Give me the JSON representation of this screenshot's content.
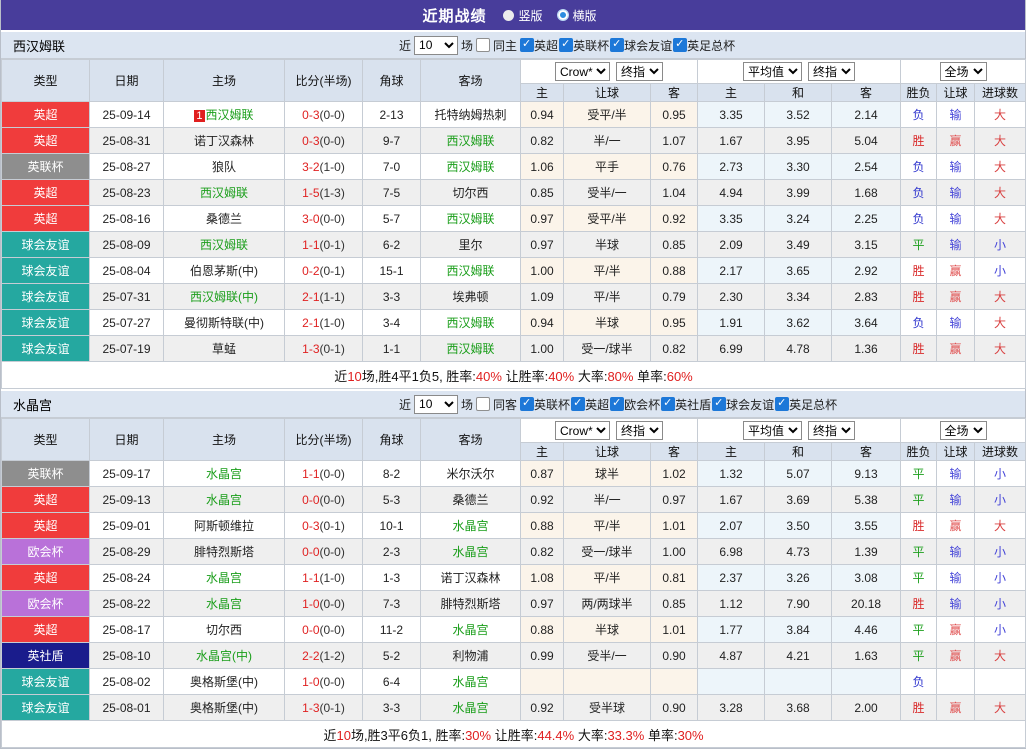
{
  "title_bar": {
    "title": "近期战绩",
    "vertical_label": "竖版",
    "horizontal_label": "横版"
  },
  "labels": {
    "near": "近",
    "games": "场"
  },
  "selects": {
    "bookmaker": "Crow*",
    "final1": "终指",
    "average": "平均值",
    "final2": "终指",
    "scope": "全场"
  },
  "columns": {
    "type": "类型",
    "date": "日期",
    "home": "主场",
    "score": "比分(半场)",
    "corner": "角球",
    "away": "客场",
    "sub": [
      "主",
      "让球",
      "客",
      "主",
      "和",
      "客",
      "胜负",
      "让球",
      "进球数"
    ]
  },
  "colors": {
    "league": {
      "英超": "#f03c3c",
      "英联杯": "#8e8e8e",
      "球会友谊": "#25a8a0",
      "欧会杯": "#b971d9",
      "英社盾": "#1a1c8c",
      "英足总杯": "#8e8e8e"
    },
    "outcome": {
      "胜": "#d92b2b",
      "平": "#1fa01f",
      "负": "#2f35ce"
    },
    "handicap": {
      "赢": "#e05050",
      "输": "#4545d8"
    },
    "goals": {
      "大": "#d94040",
      "小": "#4545d8"
    }
  },
  "sections": [
    {
      "team": "西汉姆联",
      "count": "10",
      "same_label": "同主",
      "leagues": [
        "英超",
        "英联杯",
        "球会友谊",
        "英足总杯"
      ],
      "rows": [
        {
          "type": "英超",
          "date": "25-09-14",
          "home": "西汉姆联",
          "home_focus": true,
          "rank": "1",
          "score": "0-3",
          "half": "(0-0)",
          "corner": "2-13",
          "away": "托特纳姆热刺",
          "away_focus": false,
          "lh": "0.94",
          "line": "受平/半",
          "la": "0.95",
          "ah": "3.35",
          "ad": "3.52",
          "aa": "2.14",
          "res": "负",
          "hres": "输",
          "gres": "大"
        },
        {
          "type": "英超",
          "date": "25-08-31",
          "home": "诺丁汉森林",
          "home_focus": false,
          "rank": "",
          "score": "0-3",
          "half": "(0-0)",
          "corner": "9-7",
          "away": "西汉姆联",
          "away_focus": true,
          "lh": "0.82",
          "line": "半/一",
          "la": "1.07",
          "ah": "1.67",
          "ad": "3.95",
          "aa": "5.04",
          "res": "胜",
          "hres": "赢",
          "gres": "大"
        },
        {
          "type": "英联杯",
          "date": "25-08-27",
          "home": "狼队",
          "home_focus": false,
          "rank": "",
          "score": "3-2",
          "half": "(1-0)",
          "corner": "7-0",
          "away": "西汉姆联",
          "away_focus": true,
          "lh": "1.06",
          "line": "平手",
          "la": "0.76",
          "ah": "2.73",
          "ad": "3.30",
          "aa": "2.54",
          "res": "负",
          "hres": "输",
          "gres": "大"
        },
        {
          "type": "英超",
          "date": "25-08-23",
          "home": "西汉姆联",
          "home_focus": true,
          "rank": "",
          "score": "1-5",
          "half": "(1-3)",
          "corner": "7-5",
          "away": "切尔西",
          "away_focus": false,
          "lh": "0.85",
          "line": "受半/一",
          "la": "1.04",
          "ah": "4.94",
          "ad": "3.99",
          "aa": "1.68",
          "res": "负",
          "hres": "输",
          "gres": "大"
        },
        {
          "type": "英超",
          "date": "25-08-16",
          "home": "桑德兰",
          "home_focus": false,
          "rank": "",
          "score": "3-0",
          "half": "(0-0)",
          "corner": "5-7",
          "away": "西汉姆联",
          "away_focus": true,
          "lh": "0.97",
          "line": "受平/半",
          "la": "0.92",
          "ah": "3.35",
          "ad": "3.24",
          "aa": "2.25",
          "res": "负",
          "hres": "输",
          "gres": "大"
        },
        {
          "type": "球会友谊",
          "date": "25-08-09",
          "home": "西汉姆联",
          "home_focus": true,
          "rank": "",
          "score": "1-1",
          "half": "(0-1)",
          "corner": "6-2",
          "away": "里尔",
          "away_focus": false,
          "lh": "0.97",
          "line": "半球",
          "la": "0.85",
          "ah": "2.09",
          "ad": "3.49",
          "aa": "3.15",
          "res": "平",
          "hres": "输",
          "gres": "小"
        },
        {
          "type": "球会友谊",
          "date": "25-08-04",
          "home": "伯恩茅斯(中)",
          "home_focus": false,
          "rank": "",
          "score": "0-2",
          "half": "(0-1)",
          "corner": "15-1",
          "away": "西汉姆联",
          "away_focus": true,
          "lh": "1.00",
          "line": "平/半",
          "la": "0.88",
          "ah": "2.17",
          "ad": "3.65",
          "aa": "2.92",
          "res": "胜",
          "hres": "赢",
          "gres": "小"
        },
        {
          "type": "球会友谊",
          "date": "25-07-31",
          "home": "西汉姆联(中)",
          "home_focus": true,
          "rank": "",
          "score": "2-1",
          "half": "(1-1)",
          "corner": "3-3",
          "away": "埃弗顿",
          "away_focus": false,
          "lh": "1.09",
          "line": "平/半",
          "la": "0.79",
          "ah": "2.30",
          "ad": "3.34",
          "aa": "2.83",
          "res": "胜",
          "hres": "赢",
          "gres": "大"
        },
        {
          "type": "球会友谊",
          "date": "25-07-27",
          "home": "曼彻斯特联(中)",
          "home_focus": false,
          "rank": "",
          "score": "2-1",
          "half": "(1-0)",
          "corner": "3-4",
          "away": "西汉姆联",
          "away_focus": true,
          "lh": "0.94",
          "line": "半球",
          "la": "0.95",
          "ah": "1.91",
          "ad": "3.62",
          "aa": "3.64",
          "res": "负",
          "hres": "输",
          "gres": "大"
        },
        {
          "type": "球会友谊",
          "date": "25-07-19",
          "home": "草蜢",
          "home_focus": false,
          "rank": "",
          "score": "1-3",
          "half": "(0-1)",
          "corner": "1-1",
          "away": "西汉姆联",
          "away_focus": true,
          "lh": "1.00",
          "line": "受一/球半",
          "la": "0.82",
          "ah": "6.99",
          "ad": "4.78",
          "aa": "1.36",
          "res": "胜",
          "hres": "赢",
          "gres": "大"
        }
      ],
      "stats": [
        {
          "text": "近",
          "red": false
        },
        {
          "text": "10",
          "red": true
        },
        {
          "text": "场,胜4平1负5, 胜率:",
          "red": false
        },
        {
          "text": "40%",
          "red": true
        },
        {
          "text": " 让胜率:",
          "red": false
        },
        {
          "text": "40%",
          "red": true
        },
        {
          "text": " 大率:",
          "red": false
        },
        {
          "text": "80%",
          "red": true
        },
        {
          "text": " 单率:",
          "red": false
        },
        {
          "text": "60%",
          "red": true
        }
      ]
    },
    {
      "team": "水晶宫",
      "count": "10",
      "same_label": "同客",
      "leagues": [
        "英联杯",
        "英超",
        "欧会杯",
        "英社盾",
        "球会友谊",
        "英足总杯"
      ],
      "rows": [
        {
          "type": "英联杯",
          "date": "25-09-17",
          "home": "水晶宫",
          "home_focus": true,
          "rank": "",
          "score": "1-1",
          "half": "(0-0)",
          "corner": "8-2",
          "away": "米尔沃尔",
          "away_focus": false,
          "lh": "0.87",
          "line": "球半",
          "la": "1.02",
          "ah": "1.32",
          "ad": "5.07",
          "aa": "9.13",
          "res": "平",
          "hres": "输",
          "gres": "小"
        },
        {
          "type": "英超",
          "date": "25-09-13",
          "home": "水晶宫",
          "home_focus": true,
          "rank": "",
          "score": "0-0",
          "half": "(0-0)",
          "corner": "5-3",
          "away": "桑德兰",
          "away_focus": false,
          "lh": "0.92",
          "line": "半/一",
          "la": "0.97",
          "ah": "1.67",
          "ad": "3.69",
          "aa": "5.38",
          "res": "平",
          "hres": "输",
          "gres": "小"
        },
        {
          "type": "英超",
          "date": "25-09-01",
          "home": "阿斯顿维拉",
          "home_focus": false,
          "rank": "",
          "score": "0-3",
          "half": "(0-1)",
          "corner": "10-1",
          "away": "水晶宫",
          "away_focus": true,
          "lh": "0.88",
          "line": "平/半",
          "la": "1.01",
          "ah": "2.07",
          "ad": "3.50",
          "aa": "3.55",
          "res": "胜",
          "hres": "赢",
          "gres": "大"
        },
        {
          "type": "欧会杯",
          "date": "25-08-29",
          "home": "腓特烈斯塔",
          "home_focus": false,
          "rank": "",
          "score": "0-0",
          "half": "(0-0)",
          "corner": "2-3",
          "away": "水晶宫",
          "away_focus": true,
          "lh": "0.82",
          "line": "受一/球半",
          "la": "1.00",
          "ah": "6.98",
          "ad": "4.73",
          "aa": "1.39",
          "res": "平",
          "hres": "输",
          "gres": "小"
        },
        {
          "type": "英超",
          "date": "25-08-24",
          "home": "水晶宫",
          "home_focus": true,
          "rank": "",
          "score": "1-1",
          "half": "(1-0)",
          "corner": "1-3",
          "away": "诺丁汉森林",
          "away_focus": false,
          "lh": "1.08",
          "line": "平/半",
          "la": "0.81",
          "ah": "2.37",
          "ad": "3.26",
          "aa": "3.08",
          "res": "平",
          "hres": "输",
          "gres": "小"
        },
        {
          "type": "欧会杯",
          "date": "25-08-22",
          "home": "水晶宫",
          "home_focus": true,
          "rank": "",
          "score": "1-0",
          "half": "(0-0)",
          "corner": "7-3",
          "away": "腓特烈斯塔",
          "away_focus": false,
          "lh": "0.97",
          "line": "两/两球半",
          "la": "0.85",
          "ah": "1.12",
          "ad": "7.90",
          "aa": "20.18",
          "res": "胜",
          "hres": "输",
          "gres": "小"
        },
        {
          "type": "英超",
          "date": "25-08-17",
          "home": "切尔西",
          "home_focus": false,
          "rank": "",
          "score": "0-0",
          "half": "(0-0)",
          "corner": "11-2",
          "away": "水晶宫",
          "away_focus": true,
          "lh": "0.88",
          "line": "半球",
          "la": "1.01",
          "ah": "1.77",
          "ad": "3.84",
          "aa": "4.46",
          "res": "平",
          "hres": "赢",
          "gres": "小"
        },
        {
          "type": "英社盾",
          "date": "25-08-10",
          "home": "水晶宫(中)",
          "home_focus": true,
          "rank": "",
          "score": "2-2",
          "half": "(1-2)",
          "corner": "5-2",
          "away": "利物浦",
          "away_focus": false,
          "lh": "0.99",
          "line": "受半/一",
          "la": "0.90",
          "ah": "4.87",
          "ad": "4.21",
          "aa": "1.63",
          "res": "平",
          "hres": "赢",
          "gres": "大"
        },
        {
          "type": "球会友谊",
          "date": "25-08-02",
          "home": "奥格斯堡(中)",
          "home_focus": false,
          "rank": "",
          "score": "1-0",
          "half": "(0-0)",
          "corner": "6-4",
          "away": "水晶宫",
          "away_focus": true,
          "lh": "",
          "line": "",
          "la": "",
          "ah": "",
          "ad": "",
          "aa": "",
          "res": "负",
          "hres": "",
          "gres": ""
        },
        {
          "type": "球会友谊",
          "date": "25-08-01",
          "home": "奥格斯堡(中)",
          "home_focus": false,
          "rank": "",
          "score": "1-3",
          "half": "(0-1)",
          "corner": "3-3",
          "away": "水晶宫",
          "away_focus": true,
          "lh": "0.92",
          "line": "受半球",
          "la": "0.90",
          "ah": "3.28",
          "ad": "3.68",
          "aa": "2.00",
          "res": "胜",
          "hres": "赢",
          "gres": "大"
        }
      ],
      "stats": [
        {
          "text": "近",
          "red": false
        },
        {
          "text": "10",
          "red": true
        },
        {
          "text": "场,胜3平6负1, 胜率:",
          "red": false
        },
        {
          "text": "30%",
          "red": true
        },
        {
          "text": " 让胜率:",
          "red": false
        },
        {
          "text": "44.4%",
          "red": true
        },
        {
          "text": " 大率:",
          "red": false
        },
        {
          "text": "33.3%",
          "red": true
        },
        {
          "text": " 单率:",
          "red": false
        },
        {
          "text": "30%",
          "red": true
        }
      ]
    }
  ]
}
